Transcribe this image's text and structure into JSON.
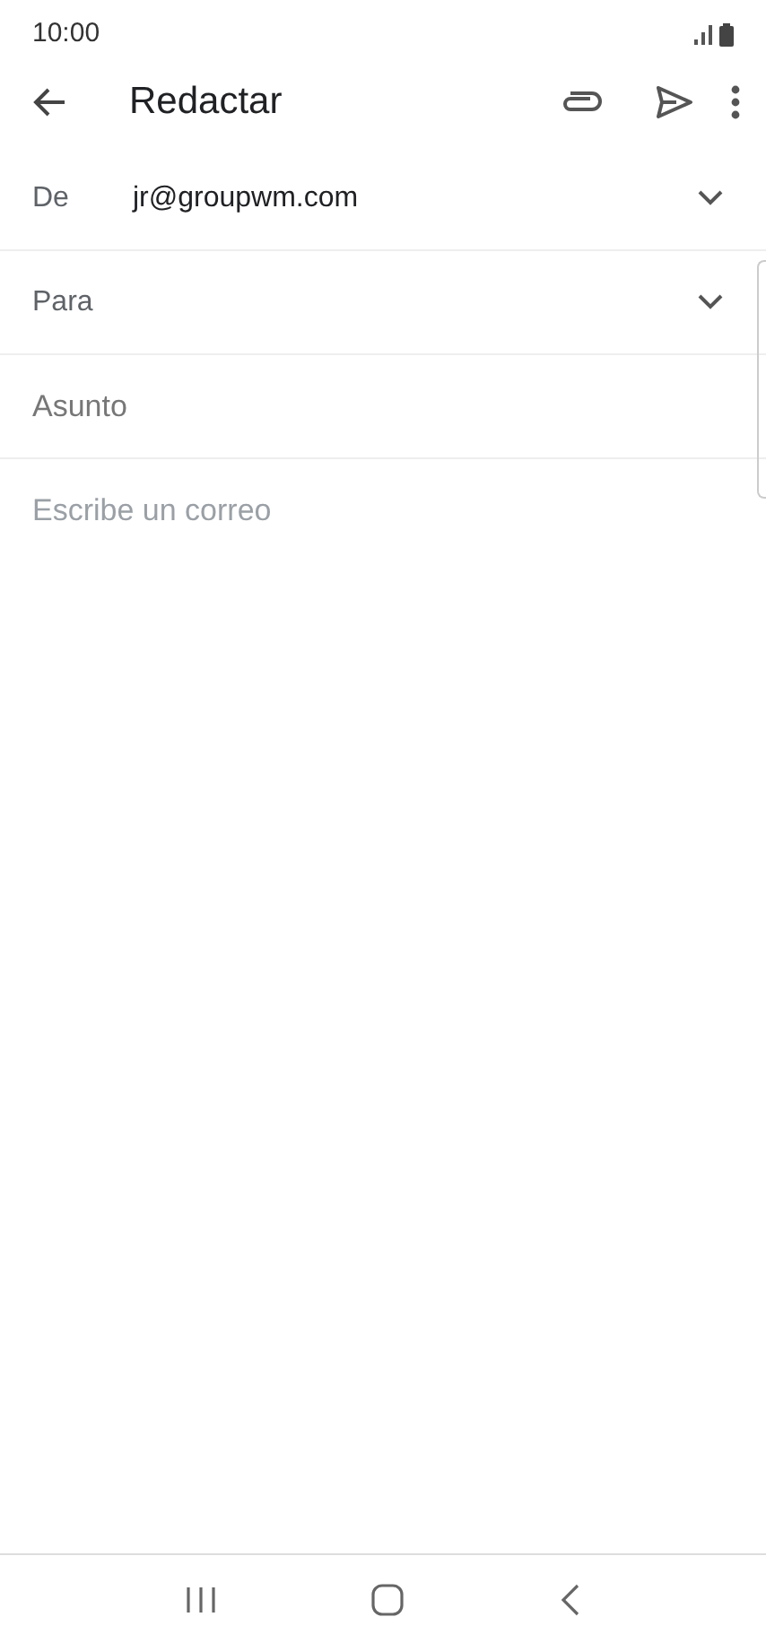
{
  "status_bar": {
    "time": "10:00"
  },
  "toolbar": {
    "title": "Redactar"
  },
  "from": {
    "label": "De",
    "value": "jr@groupwm.com"
  },
  "to": {
    "label": "Para"
  },
  "subject": {
    "placeholder": "Asunto"
  },
  "body": {
    "placeholder": "Escribe un correo"
  }
}
